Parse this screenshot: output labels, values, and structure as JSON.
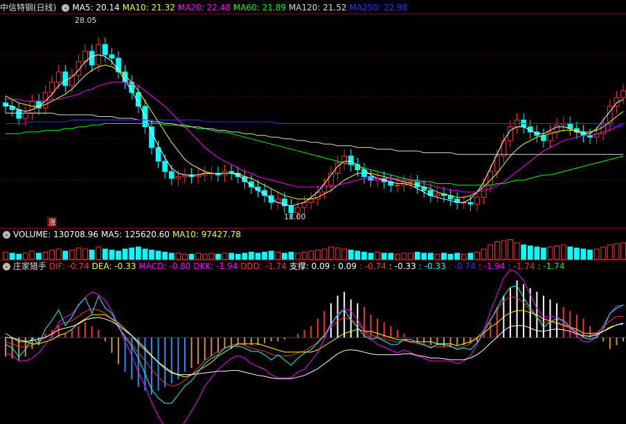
{
  "main": {
    "title": "中信特钢(日线)",
    "ma": [
      {
        "label": "MA5: 20.14",
        "color": "#ffffff"
      },
      {
        "label": "MA10: 21.32",
        "color": "#ffff00"
      },
      {
        "label": "MA20: 22.48",
        "color": "#ff00ff"
      },
      {
        "label": "MA60: 21.89",
        "color": "#00ff00"
      },
      {
        "label": "MA120: 21.52",
        "color": "#dddddd"
      },
      {
        "label": "MA250: 22.98",
        "color": "#3030ff"
      }
    ],
    "high_label": "28.05",
    "low_label": "18.00",
    "rise_marker": "涨"
  },
  "volume": {
    "items": [
      {
        "label": "VOLUME: 130708.96",
        "color": "#ffffff"
      },
      {
        "label": "MA5: 125620.60",
        "color": "#ffffff"
      },
      {
        "label": "MA10: 97427.78",
        "color": "#ffff00"
      }
    ]
  },
  "indicator": {
    "name": "庄家猎手",
    "items": [
      {
        "label": "DIF: -0.74",
        "color": "#ff3030"
      },
      {
        "label": "DEA: -0.33",
        "color": "#ffff00"
      },
      {
        "label": "MACD: -0.80",
        "color": "#ff00ff"
      },
      {
        "label": "DKK: -1.94",
        "color": "#ff00ff"
      },
      {
        "label": "DDD: -1.74",
        "color": "#ff3030"
      },
      {
        "label": "支撑: 0.09",
        "color": "#ffffff"
      },
      {
        "label": ": 0.09",
        "color": "#ffffff"
      },
      {
        "label": ": -0.74",
        "color": "#ff3030"
      },
      {
        "label": ": -0.33",
        "color": "#ffffff"
      },
      {
        "label": ": -0.33",
        "color": "#00ffff"
      },
      {
        "label": ": -0.74",
        "color": "#3030ff"
      },
      {
        "label": ": -1.94",
        "color": "#ff00ff"
      },
      {
        "label": ": -1.74",
        "color": "#ff3030"
      },
      {
        "label": ": -1.74",
        "color": "#00ff00"
      }
    ]
  },
  "chart_data": {
    "type": "line",
    "price_range": [
      17.5,
      29.5
    ],
    "close": [
      24.2,
      24.0,
      23.5,
      23.8,
      24.5,
      24.1,
      25.0,
      25.6,
      26.2,
      25.4,
      26.0,
      26.8,
      27.4,
      26.6,
      27.8,
      27.2,
      27.0,
      26.2,
      25.6,
      25.0,
      24.2,
      23.0,
      21.8,
      21.0,
      20.4,
      20.0,
      20.1,
      20.2,
      20.1,
      20.2,
      20.3,
      20.3,
      20.2,
      20.4,
      20.3,
      20.1,
      19.8,
      19.5,
      19.3,
      19.0,
      18.6,
      18.8,
      18.4,
      18.0,
      18.3,
      18.6,
      18.8,
      19.2,
      19.6,
      20.3,
      20.9,
      21.3,
      20.8,
      20.5,
      20.1,
      19.9,
      20.0,
      19.8,
      19.6,
      19.6,
      19.8,
      19.8,
      19.5,
      19.3,
      19.0,
      19.1,
      19.0,
      18.8,
      18.6,
      18.6,
      18.5,
      18.9,
      19.6,
      20.4,
      21.3,
      22.2,
      23.0,
      23.4,
      23.0,
      22.7,
      22.5,
      22.2,
      22.7,
      23.1,
      23.2,
      22.9,
      22.7,
      22.5,
      22.4,
      22.6,
      23.2,
      24.2,
      24.7,
      25.1
    ],
    "ma5": [
      24.3,
      24.2,
      24.0,
      23.9,
      24.0,
      24.2,
      24.5,
      24.9,
      25.4,
      25.7,
      25.9,
      26.3,
      26.8,
      27.1,
      27.2,
      27.1,
      26.8,
      26.3,
      25.7,
      25.1,
      24.4,
      23.6,
      22.7,
      21.9,
      21.2,
      20.6,
      20.3,
      20.2,
      20.2,
      20.2,
      20.3,
      20.3,
      20.3,
      20.3,
      20.3,
      20.2,
      19.9,
      19.6,
      19.3,
      19.1,
      18.8,
      18.6,
      18.5,
      18.4,
      18.5,
      18.6,
      18.9,
      19.2,
      19.7,
      20.2,
      20.7,
      21.0,
      21.0,
      20.8,
      20.5,
      20.2,
      20.0,
      19.9,
      19.8,
      19.7,
      19.7,
      19.6,
      19.4,
      19.2,
      19.0,
      18.9,
      18.8,
      18.7,
      18.6,
      18.6,
      18.8,
      19.2,
      19.8,
      20.6,
      21.4,
      22.2,
      22.8,
      23.0,
      23.0,
      22.8,
      22.6,
      22.6,
      22.8,
      23.0,
      23.0,
      22.9,
      22.7,
      22.6,
      22.6,
      22.9,
      23.4,
      23.9,
      24.4,
      24.6
    ],
    "ma10": [
      24.8,
      24.6,
      24.4,
      24.3,
      24.2,
      24.2,
      24.3,
      24.5,
      24.7,
      24.9,
      25.2,
      25.6,
      26.0,
      26.3,
      26.5,
      26.6,
      26.5,
      26.3,
      26.0,
      25.6,
      25.1,
      24.5,
      23.9,
      23.3,
      22.7,
      22.1,
      21.6,
      21.1,
      20.8,
      20.6,
      20.4,
      20.3,
      20.3,
      20.3,
      20.3,
      20.3,
      20.1,
      20.0,
      19.8,
      19.6,
      19.4,
      19.2,
      19.0,
      18.9,
      18.8,
      18.8,
      18.8,
      18.9,
      19.1,
      19.3,
      19.6,
      19.9,
      20.1,
      20.3,
      20.3,
      20.3,
      20.2,
      20.1,
      20.0,
      19.9,
      19.8,
      19.7,
      19.6,
      19.5,
      19.4,
      19.2,
      19.1,
      19.0,
      18.9,
      18.9,
      19.0,
      19.2,
      19.5,
      19.9,
      20.3,
      20.8,
      21.3,
      21.7,
      22.0,
      22.2,
      22.4,
      22.5,
      22.6,
      22.7,
      22.8,
      22.8,
      22.8,
      22.7,
      22.7,
      22.8,
      23.0,
      23.3,
      23.6,
      23.9
    ],
    "ma20": [
      24.6,
      24.6,
      24.6,
      24.5,
      24.5,
      24.5,
      24.5,
      24.6,
      24.6,
      24.7,
      24.8,
      24.9,
      25.1,
      25.2,
      25.4,
      25.5,
      25.6,
      25.6,
      25.6,
      25.5,
      25.4,
      25.1,
      24.8,
      24.5,
      24.2,
      23.8,
      23.4,
      23.0,
      22.6,
      22.2,
      21.8,
      21.5,
      21.2,
      21.0,
      20.8,
      20.6,
      20.4,
      20.3,
      20.1,
      20.0,
      19.9,
      19.8,
      19.7,
      19.6,
      19.5,
      19.5,
      19.5,
      19.5,
      19.5,
      19.5,
      19.6,
      19.7,
      19.8,
      19.9,
      20.0,
      20.0,
      20.0,
      20.0,
      20.0,
      20.0,
      19.9,
      19.9,
      19.8,
      19.7,
      19.6,
      19.5,
      19.4,
      19.3,
      19.3,
      19.2,
      19.2,
      19.2,
      19.3,
      19.4,
      19.6,
      19.8,
      20.1,
      20.4,
      20.7,
      21.0,
      21.3,
      21.6,
      21.8,
      22.0,
      22.2,
      22.3,
      22.4,
      22.5,
      22.5,
      22.6,
      22.7,
      22.8,
      23.0,
      23.2
    ],
    "ma60": [
      22.6,
      22.6,
      22.6,
      22.7,
      22.7,
      22.7,
      22.8,
      22.8,
      22.8,
      22.9,
      22.9,
      23.0,
      23.0,
      23.1,
      23.1,
      23.2,
      23.2,
      23.2,
      23.2,
      23.2,
      23.2,
      23.2,
      23.2,
      23.2,
      23.1,
      23.1,
      23.1,
      23.0,
      23.0,
      22.9,
      22.9,
      22.8,
      22.7,
      22.7,
      22.6,
      22.5,
      22.4,
      22.3,
      22.2,
      22.1,
      22.0,
      21.9,
      21.8,
      21.7,
      21.6,
      21.5,
      21.4,
      21.3,
      21.2,
      21.1,
      21.0,
      20.9,
      20.8,
      20.7,
      20.6,
      20.5,
      20.4,
      20.3,
      20.2,
      20.1,
      20.0,
      19.9,
      19.9,
      19.8,
      19.8,
      19.7,
      19.7,
      19.7,
      19.6,
      19.6,
      19.6,
      19.6,
      19.6,
      19.6,
      19.7,
      19.7,
      19.8,
      19.9,
      19.9,
      20.0,
      20.1,
      20.2,
      20.2,
      20.3,
      20.4,
      20.5,
      20.6,
      20.7,
      20.8,
      20.9,
      21.0,
      21.1,
      21.2,
      21.3
    ],
    "ma120": [
      23.8,
      23.8,
      23.8,
      23.8,
      23.8,
      23.8,
      23.8,
      23.8,
      23.7,
      23.7,
      23.7,
      23.7,
      23.7,
      23.7,
      23.6,
      23.6,
      23.6,
      23.5,
      23.5,
      23.5,
      23.4,
      23.4,
      23.3,
      23.3,
      23.2,
      23.2,
      23.1,
      23.1,
      23.0,
      23.0,
      22.9,
      22.9,
      22.8,
      22.8,
      22.7,
      22.7,
      22.6,
      22.6,
      22.5,
      22.5,
      22.4,
      22.4,
      22.3,
      22.3,
      22.2,
      22.2,
      22.1,
      22.1,
      22.0,
      22.0,
      21.9,
      21.9,
      21.9,
      21.8,
      21.8,
      21.8,
      21.7,
      21.7,
      21.7,
      21.6,
      21.6,
      21.6,
      21.6,
      21.5,
      21.5,
      21.5,
      21.5,
      21.5,
      21.4,
      21.4,
      21.4,
      21.4,
      21.4,
      21.4,
      21.4,
      21.4,
      21.4,
      21.4,
      21.4,
      21.4,
      21.4,
      21.4,
      21.4,
      21.4,
      21.4,
      21.4,
      21.4,
      21.4,
      21.4,
      21.4,
      21.4,
      21.4,
      21.4,
      21.4
    ],
    "ma250": [
      23.2,
      23.2,
      23.2,
      23.2,
      23.3,
      23.3,
      23.3,
      23.3,
      23.3,
      23.3,
      23.4,
      23.4,
      23.4,
      23.4,
      23.4,
      23.4,
      23.4,
      23.4,
      23.4,
      23.4,
      23.4,
      23.4,
      23.4,
      23.4,
      23.4,
      23.4,
      23.4,
      23.4,
      23.4,
      23.4,
      23.3,
      23.3,
      23.3,
      23.3,
      23.3,
      23.3,
      23.3,
      23.3,
      23.3,
      23.3,
      23.3,
      23.2,
      23.2,
      23.2,
      23.2,
      23.2,
      23.2,
      23.2,
      23.2,
      23.2,
      23.2,
      23.2,
      23.2,
      23.2,
      23.2,
      23.2,
      23.2,
      23.2,
      23.2,
      23.2,
      23.2,
      23.2,
      23.2,
      23.2,
      23.2,
      23.2,
      23.2,
      23.2,
      23.2,
      23.2,
      23.2,
      23.2,
      23.2,
      23.2,
      23.2,
      23.2,
      23.2,
      23.2,
      23.2,
      23.2,
      23.2,
      23.2,
      23.2,
      23.2,
      23.2,
      23.2,
      23.2,
      23.2,
      23.2,
      23.2,
      23.1,
      23.1,
      23.0,
      23.0
    ],
    "volume": [
      0.35,
      0.3,
      0.25,
      0.3,
      0.4,
      0.3,
      0.35,
      0.45,
      0.5,
      0.4,
      0.45,
      0.55,
      0.5,
      0.45,
      0.6,
      0.5,
      0.45,
      0.4,
      0.5,
      0.55,
      0.6,
      0.5,
      0.45,
      0.4,
      0.35,
      0.3,
      0.3,
      0.25,
      0.25,
      0.3,
      0.25,
      0.3,
      0.25,
      0.3,
      0.3,
      0.25,
      0.3,
      0.35,
      0.3,
      0.35,
      0.4,
      0.35,
      0.3,
      0.35,
      0.3,
      0.35,
      0.4,
      0.45,
      0.5,
      0.6,
      0.55,
      0.5,
      0.45,
      0.4,
      0.35,
      0.3,
      0.35,
      0.3,
      0.3,
      0.25,
      0.3,
      0.3,
      0.35,
      0.3,
      0.3,
      0.25,
      0.3,
      0.25,
      0.3,
      0.25,
      0.3,
      0.35,
      0.5,
      0.7,
      0.85,
      0.9,
      0.95,
      0.8,
      0.7,
      0.65,
      0.6,
      0.55,
      0.6,
      0.65,
      0.7,
      0.6,
      0.55,
      0.5,
      0.45,
      0.5,
      0.6,
      0.7,
      0.75,
      0.8
    ],
    "macd": [
      -0.5,
      -0.55,
      -0.6,
      -0.5,
      -0.3,
      -0.2,
      0.1,
      0.2,
      0.3,
      0.1,
      0.2,
      0.3,
      0.4,
      0.3,
      0.2,
      -0.1,
      -0.4,
      -0.7,
      -0.9,
      -1.1,
      -1.3,
      -1.4,
      -1.5,
      -1.4,
      -1.3,
      -1.2,
      -1.1,
      -0.9,
      -0.8,
      -0.7,
      -0.6,
      -0.5,
      -0.4,
      -0.3,
      -0.3,
      -0.2,
      -0.2,
      -0.2,
      -0.2,
      -0.15,
      -0.1,
      -0.1,
      -0.05,
      0.0,
      0.1,
      0.2,
      0.3,
      0.5,
      0.7,
      0.9,
      1.1,
      1.2,
      1.0,
      0.9,
      0.8,
      0.6,
      0.5,
      0.4,
      0.3,
      0.2,
      0.1,
      0.0,
      -0.1,
      -0.15,
      -0.2,
      -0.2,
      -0.25,
      -0.25,
      -0.2,
      -0.2,
      -0.15,
      -0.1,
      0.1,
      0.4,
      0.8,
      1.1,
      1.3,
      1.5,
      1.4,
      1.3,
      1.2,
      1.1,
      1.0,
      0.9,
      0.8,
      0.7,
      0.6,
      0.5,
      0.3,
      0.1,
      -0.1,
      -0.3,
      -0.2,
      -0.1
    ]
  }
}
